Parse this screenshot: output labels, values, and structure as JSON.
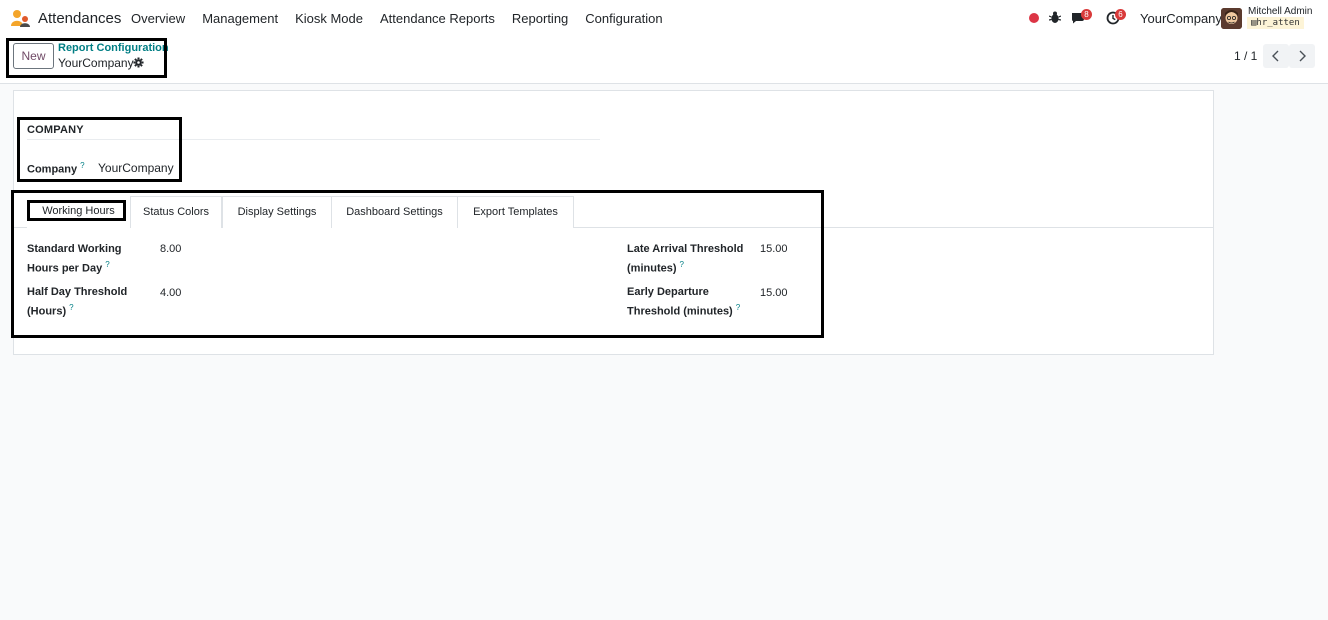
{
  "navbar": {
    "app_name": "Attendances",
    "menu": [
      "Overview",
      "Management",
      "Kiosk Mode",
      "Attendance Reports",
      "Reporting",
      "Configuration"
    ],
    "messages_count": "8",
    "activities_count": "6",
    "company": "YourCompany",
    "user_name": "Mitchell Admin",
    "database": "hr_atten"
  },
  "control_panel": {
    "new_label": "New",
    "breadcrumb": "Report Configuration",
    "record_name": "YourCompany",
    "pager": "1 / 1"
  },
  "form": {
    "group_title": "COMPANY",
    "company_label": "Company",
    "company_value": "YourCompany",
    "tabs": [
      "Working Hours",
      "Status Colors",
      "Display Settings",
      "Dashboard Settings",
      "Export Templates"
    ],
    "active_tab": "Working Hours",
    "fields": {
      "standard_hours_label_1": "Standard Working",
      "standard_hours_label_2": "Hours per Day",
      "standard_hours_value": "8.00",
      "half_day_label_1": "Half Day Threshold",
      "half_day_label_2": "(Hours)",
      "half_day_value": "4.00",
      "late_arrival_label_1": "Late Arrival Threshold",
      "late_arrival_label_2": "(minutes)",
      "late_arrival_value": "15.00",
      "early_departure_label_1": "Early Departure",
      "early_departure_label_2": "Threshold (minutes)",
      "early_departure_value": "15.00"
    },
    "help_marker": "?"
  },
  "colors": {
    "brand": "#714b67",
    "link": "#017e84",
    "badge": "#d93a3a"
  }
}
